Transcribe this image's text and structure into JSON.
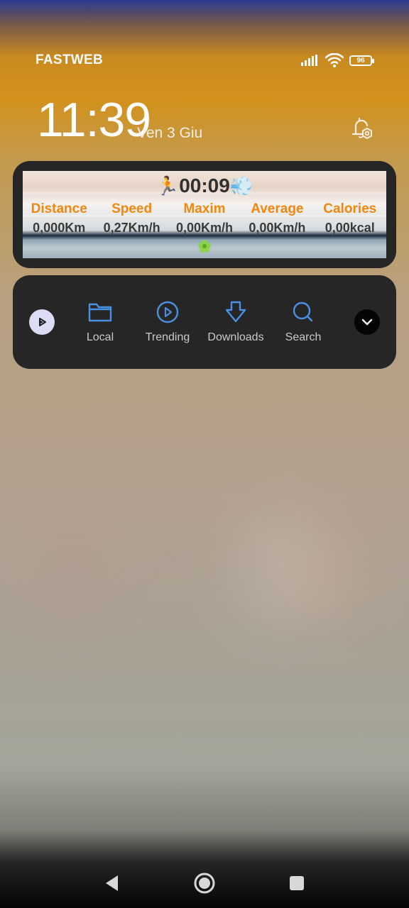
{
  "status_bar": {
    "carrier": "FASTWEB",
    "battery_level": "96",
    "icons": [
      "signal-icon",
      "wifi-icon",
      "battery-icon"
    ]
  },
  "lock_screen": {
    "time": "11:39",
    "date": "Ven 3 Giu",
    "alarm_icon": "alarm-settings-icon"
  },
  "fitness_widget": {
    "runner_emoji": "🏃",
    "timer": "00:09",
    "wind_emoji": "💨",
    "stats": [
      {
        "label": "Distance",
        "value": "0,000Km"
      },
      {
        "label": "Speed",
        "value": "0,27Km/h"
      },
      {
        "label": "Maxim",
        "value": "0,00Km/h"
      },
      {
        "label": "Average",
        "value": "0,00Km/h"
      },
      {
        "label": "Calories",
        "value": "0,00kcal"
      }
    ],
    "colors": {
      "label": "#f0870f",
      "value": "#3a3a3a",
      "flower": "#8bd34a"
    }
  },
  "player_widget": {
    "logo_icon": "play-logo-icon",
    "buttons": [
      {
        "label": "Local",
        "icon": "folder-icon"
      },
      {
        "label": "Trending",
        "icon": "play-circle-icon"
      },
      {
        "label": "Downloads",
        "icon": "download-arrow-icon"
      },
      {
        "label": "Search",
        "icon": "search-icon"
      }
    ],
    "expand_icon": "chevron-down-icon",
    "colors": {
      "accent": "#4a90e2",
      "label": "#c9c9c9"
    }
  },
  "nav_bar": {
    "icons": [
      "back-icon",
      "home-icon",
      "recents-icon"
    ]
  }
}
